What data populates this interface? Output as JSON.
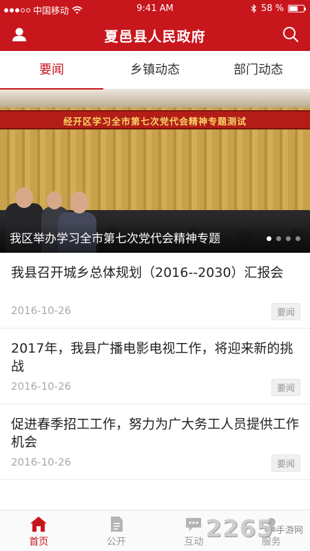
{
  "status_bar": {
    "carrier": "中国移动",
    "time": "9:41 AM",
    "battery_text": "58 %",
    "battery_level": 0.58
  },
  "header": {
    "title": "夏邑县人民政府",
    "left_icon": "user-icon",
    "right_icon": "search-icon",
    "color": "#c8161d"
  },
  "tabs": [
    {
      "label": "要闻",
      "active": true
    },
    {
      "label": "乡镇动态",
      "active": false
    },
    {
      "label": "部门动态",
      "active": false
    }
  ],
  "banner": {
    "sign_text": "经开区学习全市第七次党代会精神专题测试",
    "caption": "我区举办学习全市第七次党代会精神专题",
    "pages": 4,
    "active_page": 1
  },
  "news": [
    {
      "title": "我县召开城乡总体规划（2016--2030）汇报会",
      "date": "2016-10-26",
      "tag": "要闻"
    },
    {
      "title": "2017年，我县广播电影电视工作，将迎来新的挑战",
      "date": "2016-10-26",
      "tag": "要闻"
    },
    {
      "title": "促进春季招工工作，努力为广大务工人员提供工作机会",
      "date": "2016-10-26",
      "tag": "要闻"
    }
  ],
  "bottom_nav": [
    {
      "label": "首页",
      "icon": "home-icon",
      "active": true
    },
    {
      "label": "公开",
      "icon": "document-icon",
      "active": false
    },
    {
      "label": "互动",
      "icon": "chat-icon",
      "active": false
    },
    {
      "label": "服务",
      "icon": "service-icon",
      "active": false
    }
  ],
  "watermark": {
    "number": "2265",
    "site": "手游网"
  }
}
